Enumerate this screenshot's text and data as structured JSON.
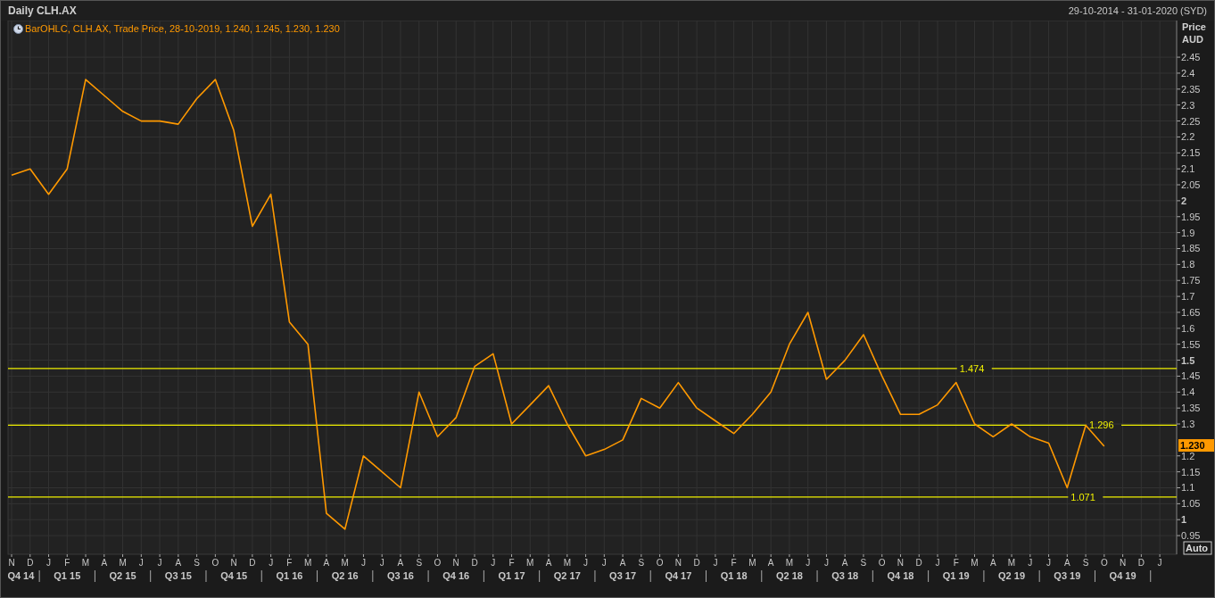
{
  "window": {
    "title": "Daily CLH.AX",
    "date_range": "29-10-2014 - 31-01-2020 (SYD)"
  },
  "chart": {
    "legend": "BarOHLC, CLH.AX, Trade Price, 28-10-2019, 1.240, 1.245, 1.230, 1.230",
    "axis_title": [
      "Price",
      "AUD"
    ],
    "price_tag": "1.230",
    "scale_button": "Auto",
    "quarter_labels": [
      "Q4 14",
      "Q1 15",
      "Q2 15",
      "Q3 15",
      "Q4 15",
      "Q1 16",
      "Q2 16",
      "Q3 16",
      "Q4 16",
      "Q1 17",
      "Q2 17",
      "Q3 17",
      "Q4 17",
      "Q1 18",
      "Q2 18",
      "Q3 18",
      "Q4 18",
      "Q1 19",
      "Q2 19",
      "Q3 19",
      "Q4 19"
    ],
    "chart_data": {
      "type": "line",
      "categories": [
        "N",
        "D",
        "J",
        "F",
        "M",
        "A",
        "M",
        "J",
        "J",
        "A",
        "S",
        "O",
        "N",
        "D",
        "J",
        "F",
        "M",
        "A",
        "M",
        "J",
        "J",
        "A",
        "S",
        "O",
        "N",
        "D",
        "J",
        "F",
        "M",
        "A",
        "M",
        "J",
        "J",
        "A",
        "S",
        "O",
        "N",
        "D",
        "J",
        "F",
        "M",
        "A",
        "M",
        "J",
        "J",
        "A",
        "S",
        "O",
        "N",
        "D",
        "J",
        "F",
        "M",
        "A",
        "M",
        "J",
        "J",
        "A",
        "S",
        "O",
        "N",
        "D",
        "J"
      ],
      "series": [
        {
          "color": "#ff9900",
          "values": [
            2.08,
            2.1,
            2.02,
            2.1,
            2.38,
            2.33,
            2.28,
            2.25,
            2.25,
            2.24,
            2.32,
            2.38,
            2.22,
            1.92,
            2.02,
            1.62,
            1.55,
            1.02,
            0.97,
            1.2,
            1.15,
            1.1,
            1.4,
            1.26,
            1.32,
            1.48,
            1.52,
            1.3,
            1.36,
            1.42,
            1.3,
            1.2,
            1.22,
            1.25,
            1.38,
            1.35,
            1.43,
            1.35,
            1.31,
            1.27,
            1.33,
            1.4,
            1.55,
            1.65,
            1.44,
            1.5,
            1.58,
            1.45,
            1.33,
            1.33,
            1.36,
            1.43,
            1.3,
            1.26,
            1.3,
            1.26,
            1.24,
            1.1,
            1.296,
            1.23,
            null,
            null,
            null
          ]
        }
      ],
      "grid": true,
      "ylim": [
        0.8915,
        2.565
      ],
      "yticks": [
        0.95,
        1,
        1.05,
        1.1,
        1.15,
        1.2,
        1.3,
        1.35,
        1.4,
        1.45,
        1.5,
        1.55,
        1.6,
        1.65,
        1.7,
        1.75,
        1.8,
        1.85,
        1.9,
        1.95,
        2,
        2.05,
        2.1,
        2.15,
        2.2,
        2.25,
        2.3,
        2.35,
        2.4,
        2.45
      ],
      "ref_lines": [
        {
          "axis": "y",
          "value": 1.474,
          "label": "1.474",
          "color": "#f0f000"
        },
        {
          "axis": "y",
          "value": 1.296,
          "label": "1.296",
          "color": "#f0f000"
        },
        {
          "axis": "y",
          "value": 1.071,
          "label": "1.071",
          "color": "#f0f000"
        }
      ]
    }
  }
}
